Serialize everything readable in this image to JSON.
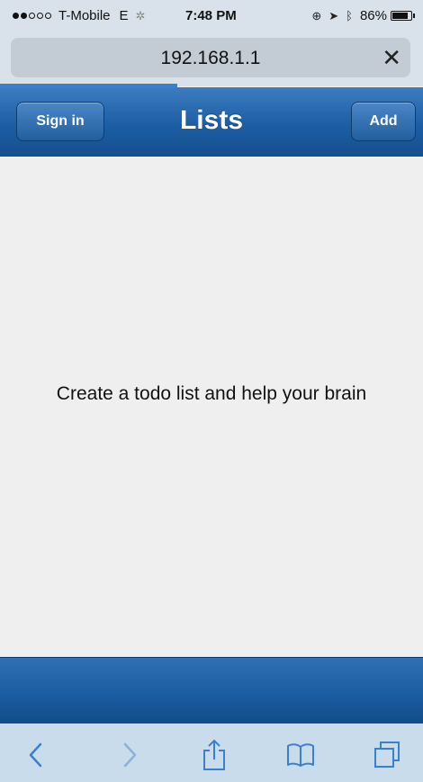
{
  "status_bar": {
    "signal_full": 2,
    "signal_total": 5,
    "carrier": "T-Mobile",
    "network": "E",
    "time": "7:48 PM",
    "battery_percent": "86%",
    "battery_level": 0.86
  },
  "browser": {
    "url": "192.168.1.1",
    "close_symbol": "✕",
    "load_progress": 0.42
  },
  "header": {
    "sign_in_label": "Sign in",
    "title": "Lists",
    "add_label": "Add"
  },
  "main": {
    "empty_message": "Create a todo list and help your brain"
  },
  "toolbar": {
    "items": [
      "back-icon",
      "forward-icon",
      "share-icon",
      "bookmarks-icon",
      "tabs-icon"
    ]
  },
  "colors": {
    "header_blue": "#1c5ea4",
    "toolbar_bg": "#c9dcec",
    "toolbar_icon": "#3b7fd0",
    "toolbar_icon_disabled": "#8fb1d6"
  }
}
